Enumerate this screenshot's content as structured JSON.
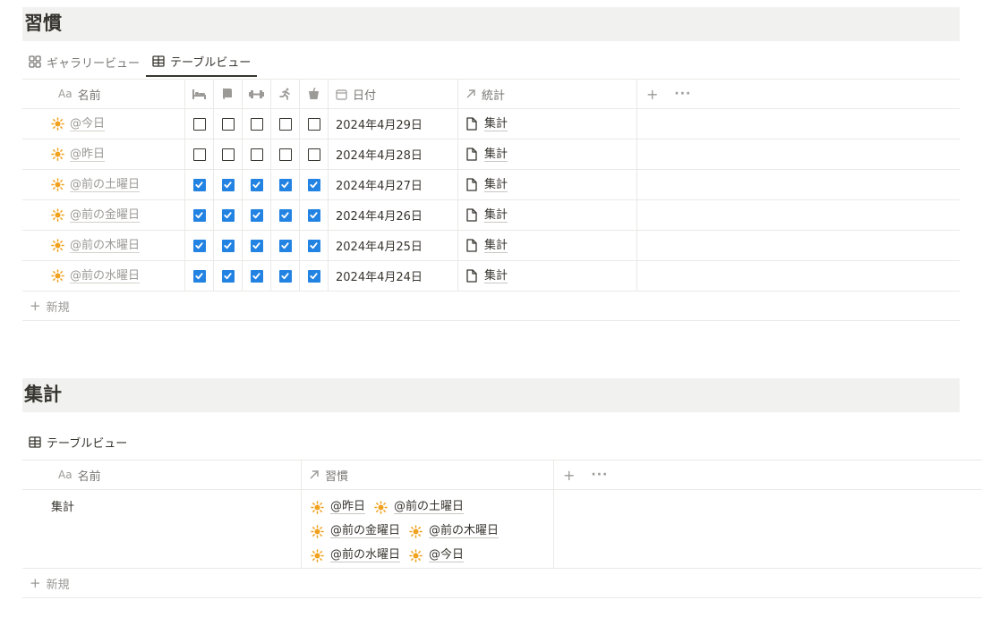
{
  "habits": {
    "title": "習慣",
    "tabs": [
      {
        "label": "ギャラリービュー",
        "icon": "gallery-icon"
      },
      {
        "label": "テーブルビュー",
        "icon": "table-icon"
      }
    ],
    "columns": {
      "name": "名前",
      "name_prefix": "Aa",
      "date": "日付",
      "stats": "統計",
      "habit_icons": [
        "bed-icon",
        "book-icon",
        "dumbbell-icon",
        "running-icon",
        "glass-icon"
      ]
    },
    "rows": [
      {
        "name": "@今日",
        "checks": [
          false,
          false,
          false,
          false,
          false
        ],
        "date": "2024年4月29日",
        "stat": "集計"
      },
      {
        "name": "@昨日",
        "checks": [
          false,
          false,
          false,
          false,
          false
        ],
        "date": "2024年4月28日",
        "stat": "集計"
      },
      {
        "name": "@前の土曜日",
        "checks": [
          true,
          true,
          true,
          true,
          true
        ],
        "date": "2024年4月27日",
        "stat": "集計"
      },
      {
        "name": "@前の金曜日",
        "checks": [
          true,
          true,
          true,
          true,
          true
        ],
        "date": "2024年4月26日",
        "stat": "集計"
      },
      {
        "name": "@前の木曜日",
        "checks": [
          true,
          true,
          true,
          true,
          true
        ],
        "date": "2024年4月25日",
        "stat": "集計"
      },
      {
        "name": "@前の水曜日",
        "checks": [
          true,
          true,
          true,
          true,
          true
        ],
        "date": "2024年4月24日",
        "stat": "集計"
      }
    ],
    "new_label": "新規"
  },
  "summary": {
    "title": "集計",
    "tab_label": "テーブルビュー",
    "columns": {
      "name": "名前",
      "name_prefix": "Aa",
      "habits": "習慣"
    },
    "row": {
      "name": "集計",
      "relations": [
        "@昨日",
        "@前の土曜日",
        "@前の金曜日",
        "@前の木曜日",
        "@前の水曜日",
        "@今日"
      ]
    },
    "new_label": "新規"
  },
  "colors": {
    "checkbox_checked": "#2383e2",
    "sun": "#f0a11e",
    "title_bg": "#f1f1ef"
  }
}
